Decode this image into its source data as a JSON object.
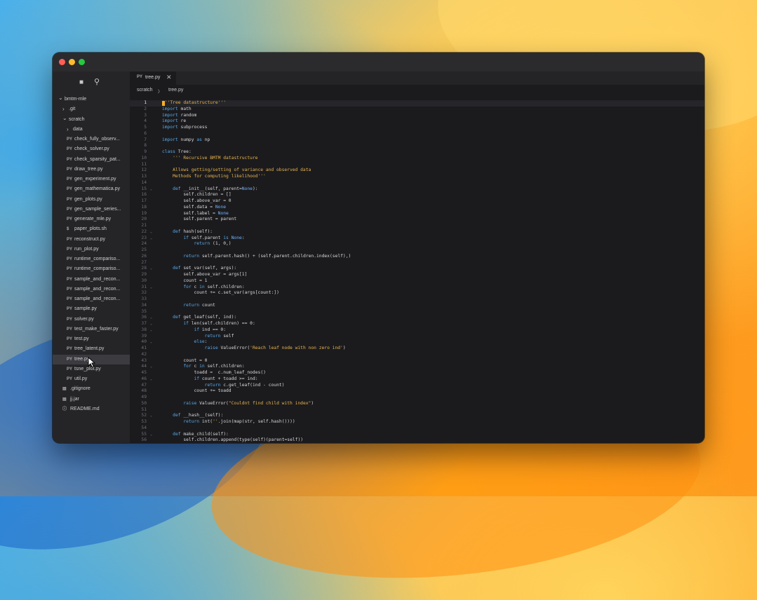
{
  "colors": {
    "traffic_close": "#ff5f57",
    "traffic_minimize": "#febc2e",
    "traffic_zoom": "#28c840",
    "keyword": "#5aa9e6",
    "string": "#e8b34b",
    "builtin_const": "#6fb3ff",
    "cursor": "#ffb020"
  },
  "sidebar": {
    "tools": [
      {
        "icon": "files-icon",
        "glyph": "■"
      },
      {
        "icon": "search-icon",
        "glyph": "⚲"
      }
    ],
    "tree": [
      {
        "label": "bmtm-mle",
        "kind": "folder",
        "depth": 0,
        "expanded": true
      },
      {
        "label": ".git",
        "kind": "folder",
        "depth": 1,
        "expanded": false
      },
      {
        "label": "scratch",
        "kind": "folder",
        "depth": 1,
        "expanded": true
      },
      {
        "label": "data",
        "kind": "folder",
        "depth": 2,
        "expanded": false
      },
      {
        "label": "check_fully_observ...",
        "kind": "file",
        "badge": "PY",
        "depth": 2
      },
      {
        "label": "check_solver.py",
        "kind": "file",
        "badge": "PY",
        "depth": 2
      },
      {
        "label": "check_sparsity_pat...",
        "kind": "file",
        "badge": "PY",
        "depth": 2
      },
      {
        "label": "draw_tree.py",
        "kind": "file",
        "badge": "PY",
        "depth": 2
      },
      {
        "label": "gen_experiment.py",
        "kind": "file",
        "badge": "PY",
        "depth": 2
      },
      {
        "label": "gen_mathematica.py",
        "kind": "file",
        "badge": "PY",
        "depth": 2
      },
      {
        "label": "gen_plots.py",
        "kind": "file",
        "badge": "PY",
        "depth": 2
      },
      {
        "label": "gen_sample_series...",
        "kind": "file",
        "badge": "PY",
        "depth": 2
      },
      {
        "label": "generate_mle.py",
        "kind": "file",
        "badge": "PY",
        "depth": 2
      },
      {
        "label": "paper_plots.sh",
        "kind": "file",
        "badge": "$",
        "depth": 2
      },
      {
        "label": "reconstruct.py",
        "kind": "file",
        "badge": "PY",
        "depth": 2
      },
      {
        "label": "run_plot.py",
        "kind": "file",
        "badge": "PY",
        "depth": 2
      },
      {
        "label": "runtime_compariso...",
        "kind": "file",
        "badge": "PY",
        "depth": 2
      },
      {
        "label": "runtime_compariso...",
        "kind": "file",
        "badge": "PY",
        "depth": 2
      },
      {
        "label": "sample_and_recon...",
        "kind": "file",
        "badge": "PY",
        "depth": 2
      },
      {
        "label": "sample_and_recon...",
        "kind": "file",
        "badge": "PY",
        "depth": 2
      },
      {
        "label": "sample_and_recon...",
        "kind": "file",
        "badge": "PY",
        "depth": 2
      },
      {
        "label": "sample.py",
        "kind": "file",
        "badge": "PY",
        "depth": 2
      },
      {
        "label": "solver.py",
        "kind": "file",
        "badge": "PY",
        "depth": 2
      },
      {
        "label": "test_make_faster.py",
        "kind": "file",
        "badge": "PY",
        "depth": 2
      },
      {
        "label": "test.py",
        "kind": "file",
        "badge": "PY",
        "depth": 2
      },
      {
        "label": "tree_latent.py",
        "kind": "file",
        "badge": "PY",
        "depth": 2
      },
      {
        "label": "tree.py",
        "kind": "file",
        "badge": "PY",
        "depth": 2,
        "selected": true
      },
      {
        "label": "tsne_plot.py",
        "kind": "file",
        "badge": "PY",
        "depth": 2
      },
      {
        "label": "util.py",
        "kind": "file",
        "badge": "PY",
        "depth": 2
      },
      {
        "label": ".gitignore",
        "kind": "file",
        "badge": "▤",
        "depth": 1
      },
      {
        "label": "jj.jar",
        "kind": "file",
        "badge": "▤",
        "depth": 1
      },
      {
        "label": "README.md",
        "kind": "file",
        "badge": "ⓘ",
        "depth": 1
      }
    ]
  },
  "editor": {
    "tab": {
      "badge": "PY",
      "label": "tree.py",
      "close": "✕"
    },
    "breadcrumb": [
      "scratch",
      "tree.py"
    ],
    "breadcrumb_sep": "〉",
    "current_line": 1,
    "lines": [
      {
        "n": 1,
        "text": "'''Tree datastructure'''"
      },
      {
        "n": 2,
        "text": "import math"
      },
      {
        "n": 3,
        "text": "import random"
      },
      {
        "n": 4,
        "text": "import re"
      },
      {
        "n": 5,
        "text": "import subprocess"
      },
      {
        "n": 6,
        "text": ""
      },
      {
        "n": 7,
        "text": "import numpy as np"
      },
      {
        "n": 8,
        "text": ""
      },
      {
        "n": 9,
        "text": "class Tree:"
      },
      {
        "n": 10,
        "text": "    ''' Recursive BMTM datastructure"
      },
      {
        "n": 11,
        "text": ""
      },
      {
        "n": 12,
        "text": "    Allows getting/setting of variance and observed data"
      },
      {
        "n": 13,
        "text": "    Methods for computing likelihood'''"
      },
      {
        "n": 14,
        "text": ""
      },
      {
        "n": 15,
        "text": "    def __init__(self, parent=None):",
        "fold": true
      },
      {
        "n": 16,
        "text": "        self.children = []"
      },
      {
        "n": 17,
        "text": "        self.above_var = 0"
      },
      {
        "n": 18,
        "text": "        self.data = None"
      },
      {
        "n": 19,
        "text": "        self.label = None"
      },
      {
        "n": 20,
        "text": "        self.parent = parent"
      },
      {
        "n": 21,
        "text": ""
      },
      {
        "n": 22,
        "text": "    def hash(self):",
        "fold": true
      },
      {
        "n": 23,
        "text": "        if self.parent is None:",
        "fold": true
      },
      {
        "n": 24,
        "text": "            return (1, 0,)"
      },
      {
        "n": 25,
        "text": ""
      },
      {
        "n": 26,
        "text": "        return self.parent.hash() + (self.parent.children.index(self),)"
      },
      {
        "n": 27,
        "text": ""
      },
      {
        "n": 28,
        "text": "    def set_var(self, args):",
        "fold": true
      },
      {
        "n": 29,
        "text": "        self.above_var = args[1]"
      },
      {
        "n": 30,
        "text": "        count = 1"
      },
      {
        "n": 31,
        "text": "        for c in self.children:",
        "fold": true
      },
      {
        "n": 32,
        "text": "            count += c.set_var(args[count:])"
      },
      {
        "n": 33,
        "text": ""
      },
      {
        "n": 34,
        "text": "        return count"
      },
      {
        "n": 35,
        "text": ""
      },
      {
        "n": 36,
        "text": "    def get_leaf(self, ind):",
        "fold": true
      },
      {
        "n": 37,
        "text": "        if len(self.children) == 0:",
        "fold": true
      },
      {
        "n": 38,
        "text": "            if ind == 0:",
        "fold": true
      },
      {
        "n": 39,
        "text": "                return self"
      },
      {
        "n": 40,
        "text": "            else:",
        "fold": true
      },
      {
        "n": 41,
        "text": "                raise ValueError('Reach leaf node with non zero ind')"
      },
      {
        "n": 42,
        "text": ""
      },
      {
        "n": 43,
        "text": "        count = 0"
      },
      {
        "n": 44,
        "text": "        for c in self.children:",
        "fold": true
      },
      {
        "n": 45,
        "text": "            toadd =  c.num_leaf_nodes()"
      },
      {
        "n": 46,
        "text": "            if count + toadd >= ind:",
        "fold": true
      },
      {
        "n": 47,
        "text": "                return c.get_leaf(ind - count)"
      },
      {
        "n": 48,
        "text": "            count += toadd"
      },
      {
        "n": 49,
        "text": ""
      },
      {
        "n": 50,
        "text": "        raise ValueError(\"Couldnt find child with index\")"
      },
      {
        "n": 51,
        "text": ""
      },
      {
        "n": 52,
        "text": "    def __hash__(self):",
        "fold": true
      },
      {
        "n": 53,
        "text": "        return int(''.join(map(str, self.hash())))"
      },
      {
        "n": 54,
        "text": ""
      },
      {
        "n": 55,
        "text": "    def make_child(self):",
        "fold": true
      },
      {
        "n": 56,
        "text": "        self.children.append(type(self)(parent=self))"
      },
      {
        "n": 57,
        "text": ""
      }
    ]
  }
}
